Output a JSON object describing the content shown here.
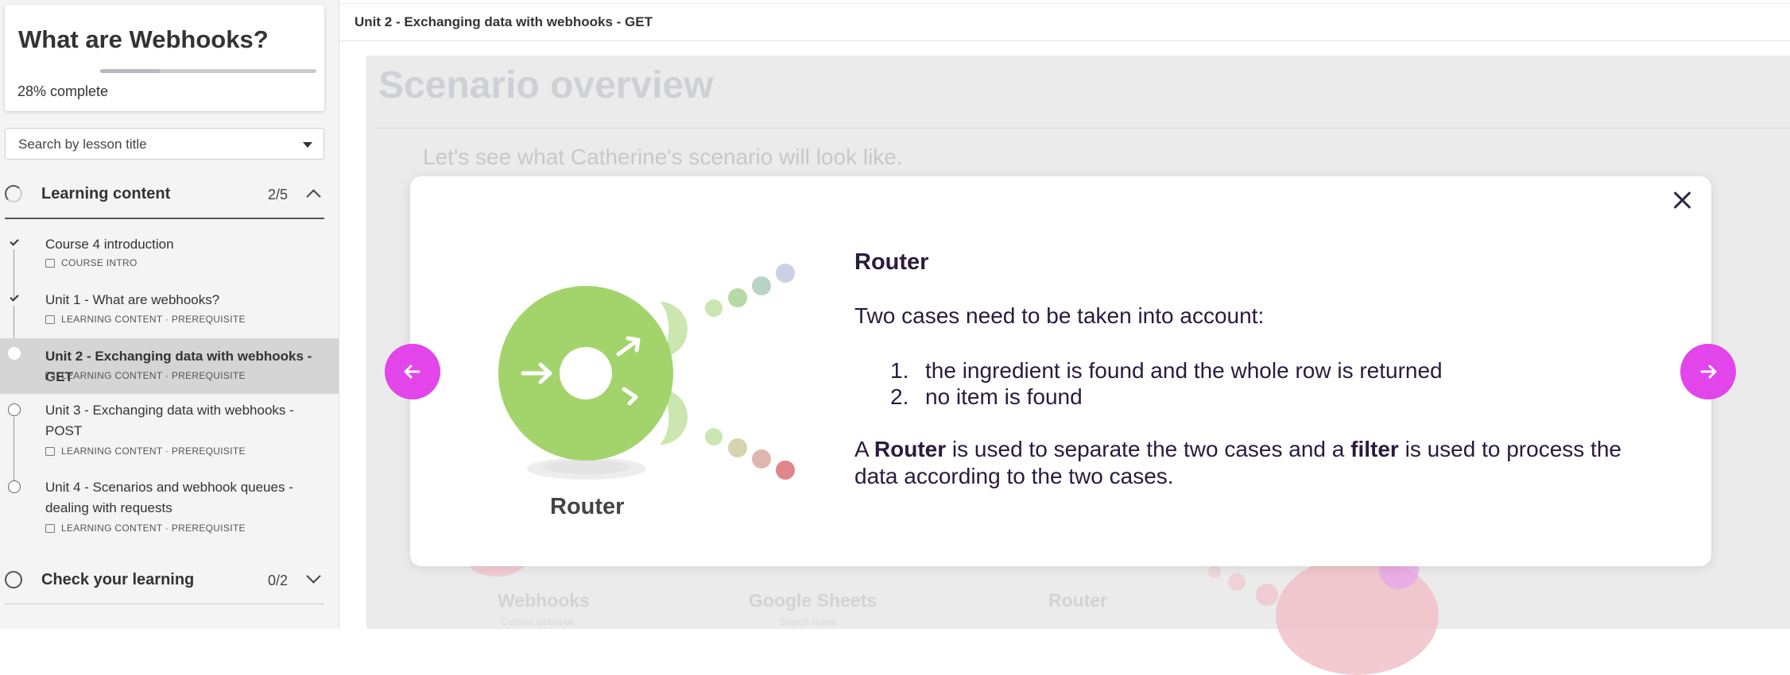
{
  "sidebar": {
    "course_title": "What are Webhooks?",
    "progress_percent": "28%",
    "progress_suffix": " complete",
    "progress_value": 0.28,
    "search_placeholder": "Search by lesson title",
    "sections": [
      {
        "label": "Learning content",
        "count": "2/5",
        "lessons": [
          {
            "title": "Course 4 introduction",
            "meta": "COURSE INTRO",
            "status": "complete"
          },
          {
            "title": "Unit 1 - What are webhooks?",
            "meta": "LEARNING CONTENT · PREREQUISITE",
            "status": "complete"
          },
          {
            "title": "Unit 2 - Exchanging data with webhooks - GET",
            "meta": "LEARNING CONTENT · PREREQUISITE",
            "status": "current"
          },
          {
            "title": "Unit 3 - Exchanging data with webhooks - POST",
            "meta": "LEARNING CONTENT · PREREQUISITE",
            "status": "incomplete"
          },
          {
            "title": "Unit 4 - Scenarios and webhook queues - dealing with requests",
            "meta": "LEARNING CONTENT · PREREQUISITE",
            "status": "incomplete"
          }
        ]
      },
      {
        "label": "Check your learning",
        "count": "0/2"
      }
    ]
  },
  "main": {
    "unit_title": "Unit 2 - Exchanging data with webhooks - GET",
    "scenario_title": "Scenario overview",
    "scenario_subtitle": "Let's see what Catherine's scenario will look like.",
    "bg_modules": [
      {
        "label": "Webhooks",
        "sub": "Custom webhook"
      },
      {
        "label": "Google Sheets",
        "sub": "Search Rows"
      },
      {
        "label": "Router"
      }
    ]
  },
  "modal": {
    "image_caption": "Router",
    "title": "Router",
    "intro": "Two cases need to be taken into account:",
    "list": [
      {
        "num": "1.",
        "text": "the ingredient is found and the whole row is returned"
      },
      {
        "num": "2.",
        "text": "no item is found"
      }
    ],
    "para": {
      "p1": "A ",
      "b1": "Router",
      "p2": " is used to separate the two cases and a ",
      "b2": "filter",
      "p3": " is used to process the data according to the two cases."
    }
  },
  "colors": {
    "accent": "#e245ea",
    "router_green": "#a3d46c",
    "text_dark": "#2b1a3d"
  },
  "icons": [
    "check-icon",
    "lesson-doc-icon",
    "lesson-slides-icon",
    "chevron-up-icon",
    "chevron-down-icon",
    "close-icon",
    "arrow-left-icon",
    "arrow-right-icon",
    "router-icon"
  ]
}
